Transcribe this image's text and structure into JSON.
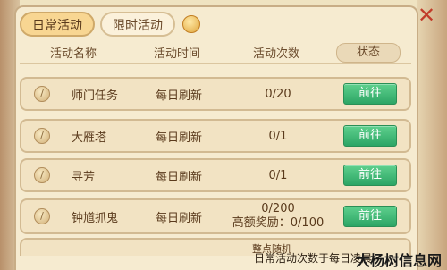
{
  "tabs": [
    {
      "label": "日常活动",
      "active": true
    },
    {
      "label": "限时活动",
      "active": false
    }
  ],
  "icons": {
    "tab_extra": "coin-icon",
    "close": "close-icon",
    "row_badge": "task-badge-icon"
  },
  "close_label": "✕",
  "table": {
    "headers": [
      "活动名称",
      "活动时间",
      "活动次数",
      "状态"
    ],
    "rows": [
      {
        "name": "师门任务",
        "time": "每日刷新",
        "count": "0/20",
        "button": "前往"
      },
      {
        "name": "大雁塔",
        "time": "每日刷新",
        "count": "0/1",
        "button": "前往"
      },
      {
        "name": "寻芳",
        "time": "每日刷新",
        "count": "0/1",
        "button": "前往"
      },
      {
        "name": "钟馗抓鬼",
        "time": "每日刷新",
        "count": "0/200",
        "count2": "高额奖励：0/100",
        "button": "前往"
      }
    ],
    "partial_row_text": "整点随机"
  },
  "footer_note": "日常活动次数于每日凌晨",
  "watermark": "大杨树信息网",
  "colors": {
    "accent_green": "#2da565",
    "panel": "#f6ebd0",
    "close_red": "#c23b2a"
  }
}
